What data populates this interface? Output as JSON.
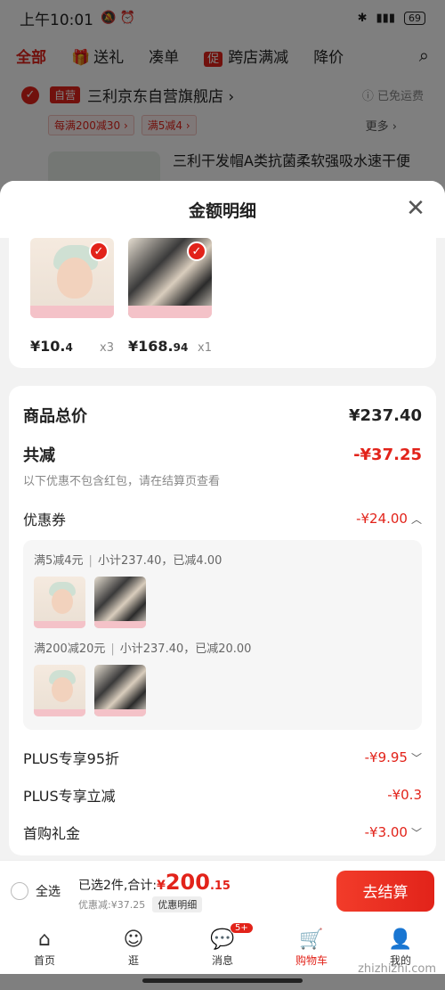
{
  "status_bar": {
    "time": "上午10:01",
    "battery": "69"
  },
  "top_nav": {
    "items": [
      "全部",
      "送礼",
      "凑单",
      "跨店满减",
      "降价"
    ],
    "promo_tag": "促"
  },
  "store": {
    "self_tag": "自营",
    "name": "三利京东自营旗舰店 ›",
    "shipping": "ⓘ 已免运费",
    "promos": [
      "每满200减30 ›",
      "满5减4 ›"
    ],
    "more": "更多 ›",
    "product_title": "三利干发帽A类抗菌柔软强吸水速干便"
  },
  "sheet": {
    "title": "金额明细",
    "products": [
      {
        "price_int": "¥10.",
        "price_dec": "4",
        "qty": "x3"
      },
      {
        "price_int": "¥168.",
        "price_dec": "94",
        "qty": "x1"
      }
    ],
    "total_label": "商品总价",
    "total_value": "¥237.40",
    "reduce_label": "共减",
    "reduce_value": "-¥37.25",
    "note": "以下优惠不包含红包，请在结算页查看",
    "coupon_label": "优惠券",
    "coupon_value": "-¥24.00",
    "coupon_lines": [
      {
        "rule": "满5减4元",
        "detail": "小计237.40，已减4.00"
      },
      {
        "rule": "满200减20元",
        "detail": "小计237.40，已减20.00"
      }
    ],
    "plus95_label": "PLUS专享95折",
    "plus95_value": "-¥9.95",
    "plus_instant_label": "PLUS专享立减",
    "plus_instant_value": "-¥0.3",
    "first_gift_label": "首购礼金",
    "first_gift_value": "-¥3.00"
  },
  "checkout": {
    "select_all": "全选",
    "selected": "已选2件,合计:",
    "yen": "¥",
    "total_big": "200",
    "total_small": ".15",
    "discount": "优惠减:¥37.25",
    "detail_button": "优惠明细",
    "pay_button": "去结算"
  },
  "tabbar": {
    "items": [
      "首页",
      "逛",
      "消息",
      "购物车",
      "我的"
    ],
    "msg_badge": "5+"
  },
  "watermark": "zhizhizhi.com"
}
